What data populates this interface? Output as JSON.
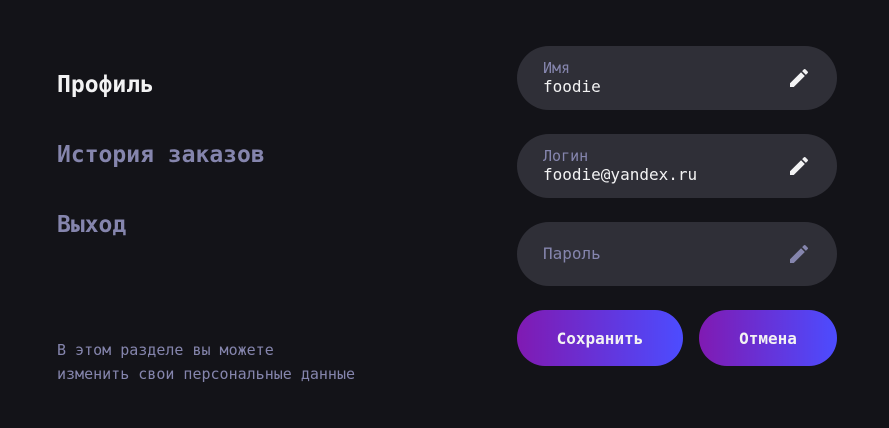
{
  "nav": {
    "profile": "Профиль",
    "history": "История заказов",
    "logout": "Выход",
    "hint_line1": "В этом разделе вы можете",
    "hint_line2": "изменить свои персональные данные"
  },
  "form": {
    "name": {
      "label": "Имя",
      "value": "foodie",
      "icon": "pencil-edit-icon"
    },
    "login": {
      "label": "Логин",
      "value": "foodie@yandex.ru",
      "icon": "pencil-edit-icon"
    },
    "password": {
      "label": "Пароль",
      "value": "",
      "icon": "pencil-edit-icon-muted"
    },
    "save_label": "Сохранить",
    "cancel_label": "Отмена"
  },
  "colors": {
    "background": "#131318",
    "field_bg": "#2f2f37",
    "text_primary": "#f2f2f3",
    "text_inactive": "#8585ad",
    "button_gradient_start": "#801ab2",
    "button_gradient_end": "#4c4cff"
  }
}
